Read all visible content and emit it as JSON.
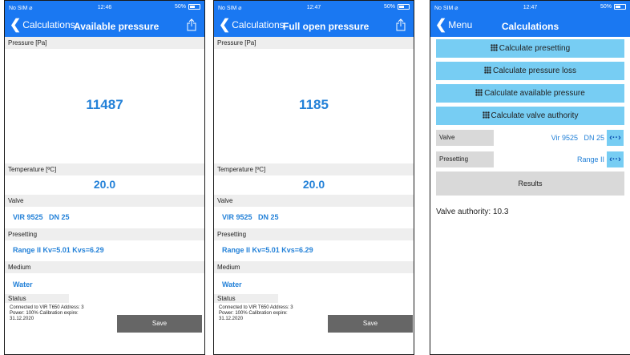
{
  "screen1": {
    "status": {
      "carrier": "No SIM ⌀",
      "time": "12:46",
      "battery": "50%",
      "battery_level": 0.5
    },
    "nav": {
      "back_label": "Calculations",
      "title": "Available pressure"
    },
    "pressure_label": "Pressure [Pa]",
    "pressure_value": "11487",
    "temperature_label": "Temperature [ºC]",
    "temperature_value": "20.0",
    "valve_label": "Valve",
    "valve_value": "VIR 9525   DN 25",
    "presetting_label": "Presetting",
    "presetting_value": "Range II Kv=5.01 Kvs=6.29",
    "medium_label": "Medium",
    "medium_value": "Water",
    "status_label": "Status",
    "status_line1": "Connected to VIR T650 Address: 3",
    "status_line2": "Power: 100% Calibration expire:",
    "status_line3": "31.12.2020",
    "save_label": "Save"
  },
  "screen2": {
    "status": {
      "carrier": "No SIM ⌀",
      "time": "12:47",
      "battery": "50%",
      "battery_level": 0.5
    },
    "nav": {
      "back_label": "Calculations",
      "title": "Full open pressure"
    },
    "pressure_label": "Pressure [Pa]",
    "pressure_value": "1185",
    "temperature_label": "Temperature [ºC]",
    "temperature_value": "20.0",
    "valve_label": "Valve",
    "valve_value": "VIR 9525   DN 25",
    "presetting_label": "Presetting",
    "presetting_value": "Range II Kv=5.01 Kvs=6.29",
    "medium_label": "Medium",
    "medium_value": "Water",
    "status_label": "Status",
    "status_line1": "Connected to VIR T650 Address: 3",
    "status_line2": "Power: 100% Calibration expire:",
    "status_line3": "31.12.2020",
    "save_label": "Save"
  },
  "screen3": {
    "status": {
      "carrier": "No SIM ⌀",
      "time": "12:47",
      "battery": "50%",
      "battery_level": 0.5
    },
    "nav": {
      "back_label": "Menu",
      "title": "Calculations"
    },
    "buttons": [
      {
        "label": "Calculate presetting"
      },
      {
        "label": "Calculate pressure loss"
      },
      {
        "label": "Calculate available pressure"
      },
      {
        "label": "Calculate valve authority"
      }
    ],
    "valve_label": "Valve",
    "valve_value": "Vir 9525   DN 25",
    "presetting_label": "Presetting",
    "presetting_value": "Range II",
    "arrows_glyph": "‹··›",
    "results_label": "Results",
    "authority_text": "Valve authority: 10.3"
  },
  "colors": {
    "nav_blue": "#1a78f2",
    "value_blue": "#2381d8",
    "button_cyan": "#77cdf3",
    "save_gray": "#666666"
  }
}
